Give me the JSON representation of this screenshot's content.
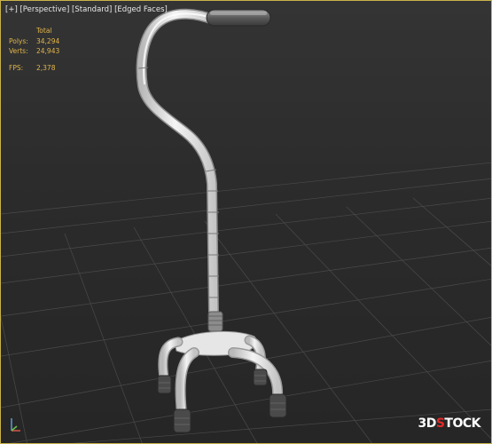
{
  "viewport": {
    "label_plus": "[+]",
    "label_view": "[Perspective]",
    "label_shading": "[Standard]",
    "label_mode": "[Edged Faces]"
  },
  "stats": {
    "header": "Total",
    "polys_label": "Polys:",
    "polys_value": "34,294",
    "verts_label": "Verts:",
    "verts_value": "24,943",
    "fps_label": "FPS:",
    "fps_value": "2,378"
  },
  "watermark": {
    "part1": "3D",
    "part2": "S",
    "part3": "TOCK"
  },
  "colors": {
    "border": "#c9b24a",
    "stats_text": "#e2b64a",
    "watermark_red": "#e32a2a"
  }
}
